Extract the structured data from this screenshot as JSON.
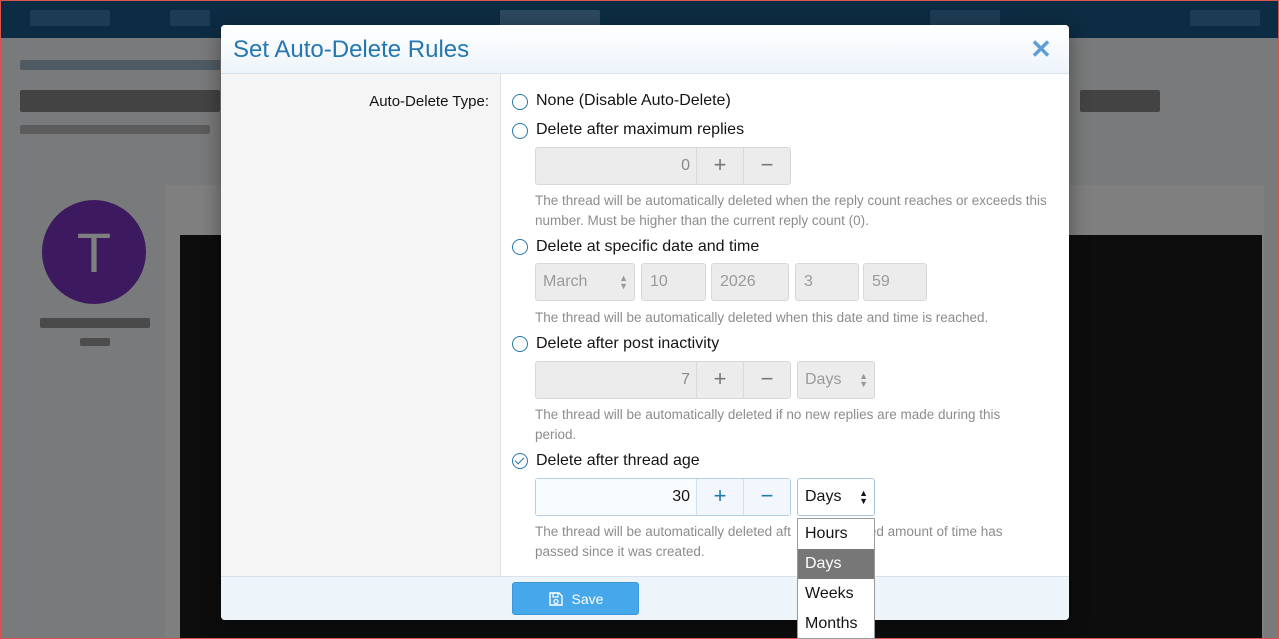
{
  "modal": {
    "title": "Set Auto-Delete Rules",
    "close_label": "✕",
    "field_label": "Auto-Delete Type:",
    "options": [
      {
        "label": "None (Disable Auto-Delete)",
        "checked": false
      },
      {
        "label": "Delete after maximum replies",
        "checked": false
      },
      {
        "label": "Delete at specific date and time",
        "checked": false
      },
      {
        "label": "Delete after post inactivity",
        "checked": false
      },
      {
        "label": "Delete after thread age",
        "checked": true
      }
    ],
    "max_replies": {
      "value": "0",
      "plus": "+",
      "minus": "−",
      "help": "The thread will be automatically deleted when the reply count reaches or exceeds this number. Must be higher than the current reply count (0)."
    },
    "specific_date": {
      "month": "March",
      "day": "10",
      "year": "2026",
      "hour": "3",
      "minute": "59",
      "help": "The thread will be automatically deleted when this date and time is reached."
    },
    "inactivity": {
      "value": "7",
      "plus": "+",
      "minus": "−",
      "unit": "Days",
      "help": "The thread will be automatically deleted if no new replies are made during this period."
    },
    "thread_age": {
      "value": "30",
      "plus": "+",
      "minus": "−",
      "unit": "Days",
      "help_before": "The thread will be automatically deleted aft",
      "help_after": "ed amount of time has",
      "help_line2": "passed since it was created."
    },
    "unit_dropdown": {
      "options": [
        "Hours",
        "Days",
        "Weeks",
        "Months"
      ],
      "selected": "Days"
    },
    "save_label": "Save"
  },
  "background": {
    "avatar_letter": "T"
  },
  "colors": {
    "accent": "#2577b1",
    "save_button": "#47a7eb",
    "nav": "#185886",
    "avatar": "#7b35bf"
  }
}
